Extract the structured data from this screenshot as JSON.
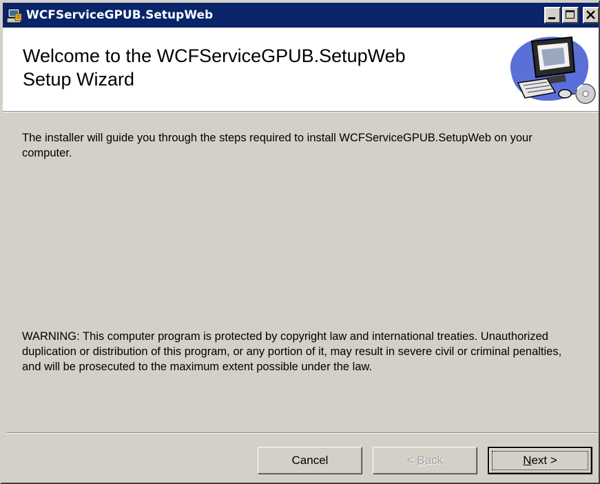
{
  "window": {
    "title": "WCFServiceGPUB.SetupWeb",
    "app_icon": "installer-icon",
    "controls": {
      "minimize_icon": "minimize-icon",
      "maximize_icon": "maximize-icon",
      "close_icon": "close-icon"
    }
  },
  "banner": {
    "title": "Welcome to the WCFServiceGPUB.SetupWeb\nSetup Wizard",
    "art_icon": "computer-setup-icon"
  },
  "content": {
    "intro": "The installer will guide you through the steps required to install WCFServiceGPUB.SetupWeb on your computer.",
    "warning": "WARNING: This computer program is protected by copyright law and international treaties. Unauthorized duplication or distribution of this program, or any portion of it, may result in severe civil or criminal penalties, and will be prosecuted to the maximum extent possible under the law."
  },
  "buttons": {
    "cancel": "Cancel",
    "back_prefix": "< ",
    "back_mnemonic": "B",
    "back_rest": "ack",
    "next_mnemonic": "N",
    "next_rest": "ext >"
  },
  "colors": {
    "titlebar": "#0a246a",
    "dialog_face": "#d4d0c8",
    "banner_bg": "#ffffff",
    "disabled_text": "#a0a0a0"
  }
}
